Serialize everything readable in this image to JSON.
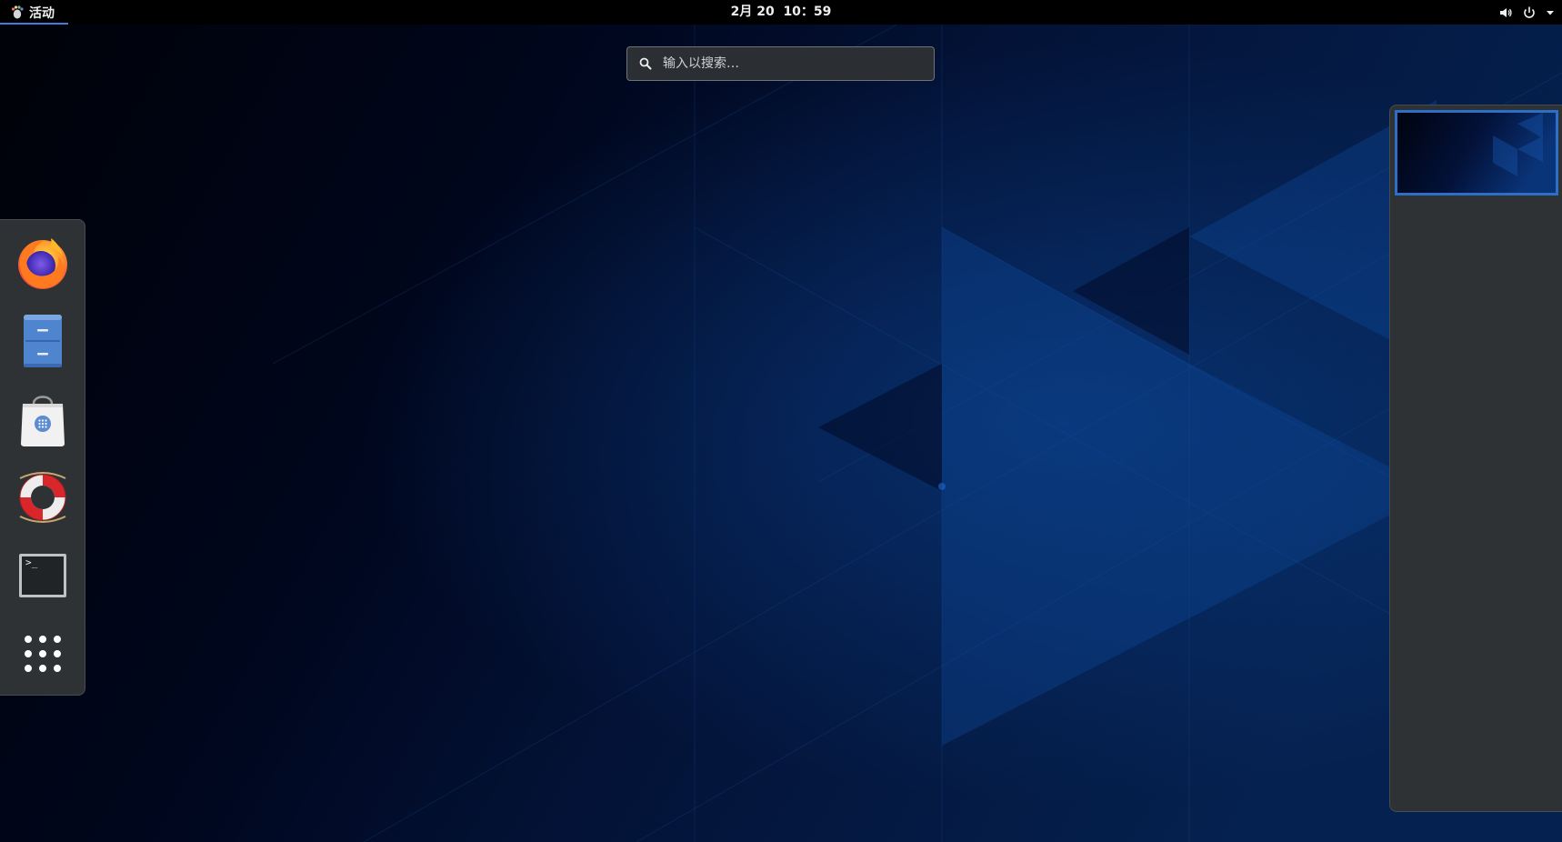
{
  "topbar": {
    "activities_label": "活动",
    "clock": "2月 20  10：59",
    "status_icons": [
      "volume-icon",
      "power-icon",
      "dropdown-arrow-icon"
    ]
  },
  "search": {
    "placeholder": "输入以搜索…"
  },
  "dash": {
    "items": [
      {
        "name": "Firefox",
        "icon": "firefox-icon"
      },
      {
        "name": "Files",
        "icon": "file-cabinet-icon"
      },
      {
        "name": "Software",
        "icon": "shopping-bag-icon"
      },
      {
        "name": "Help",
        "icon": "lifebuoy-icon"
      },
      {
        "name": "Terminal",
        "icon": "terminal-icon",
        "prompt": ">_"
      },
      {
        "name": "Show Applications",
        "icon": "app-grid-icon"
      }
    ]
  },
  "workspaces": {
    "count": 1,
    "active_index": 0
  },
  "colors": {
    "topbar_bg": "#000000",
    "panel_bg": "#2e3235",
    "accent": "#2d6ec6",
    "wallpaper_dark": "#00051a",
    "wallpaper_blue": "#0a3a7a"
  }
}
